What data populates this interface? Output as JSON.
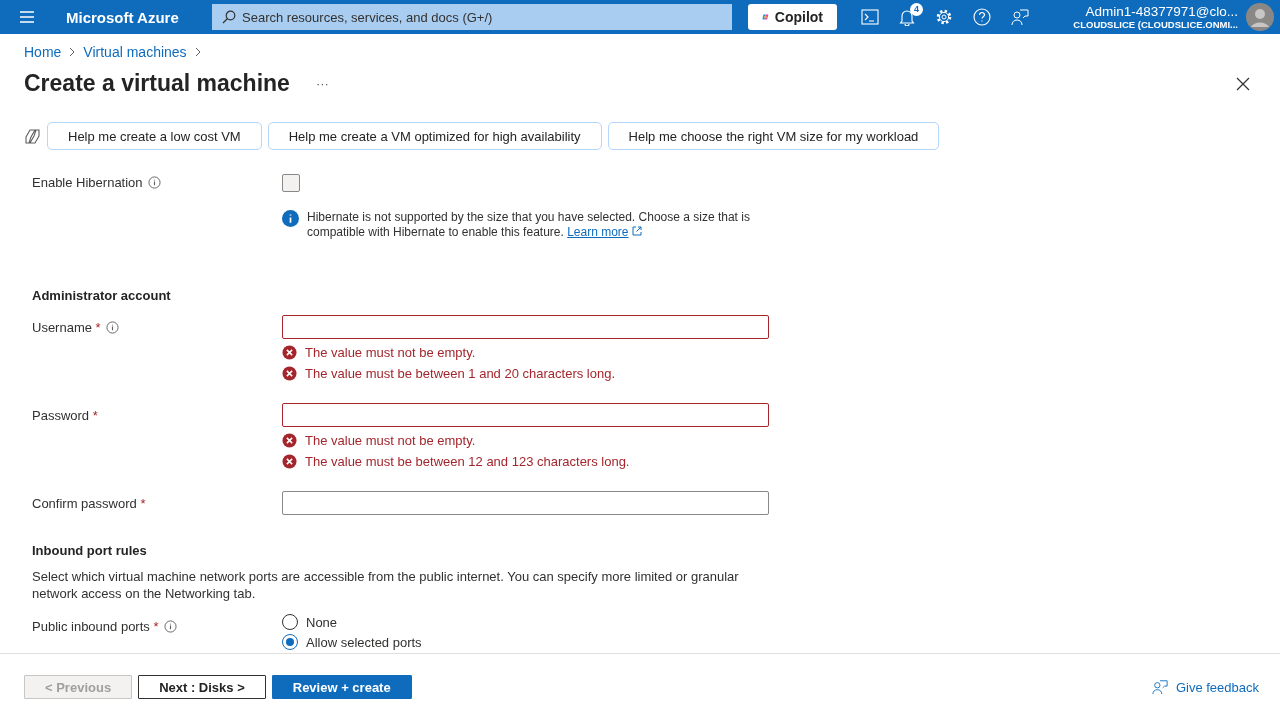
{
  "topbar": {
    "brand": "Microsoft Azure",
    "search": {
      "placeholder": "Search resources, services, and docs (G+/)"
    },
    "copilot": "Copilot",
    "notifications_badge": "4",
    "account": {
      "name": "Admin1-48377971@clo...",
      "tenant": "CLOUDSLICE (CLOUDSLICE.ONMI..."
    }
  },
  "breadcrumb": [
    "Home",
    "Virtual machines"
  ],
  "page": {
    "title": "Create a virtual machine",
    "more": "···"
  },
  "suggestions": [
    "Help me create a low cost VM",
    "Help me create a VM optimized for high availability",
    "Help me choose the right VM size for my workload"
  ],
  "hibernation": {
    "label": "Enable Hibernation",
    "checked": false,
    "info": "Hibernate is not supported by the size that you have selected. Choose a size that is compatible with Hibernate to enable this feature.",
    "link": "Learn more"
  },
  "admin": {
    "heading": "Administrator account",
    "fields": [
      {
        "label": "Username",
        "required_mark": "*",
        "info": true,
        "invalid": true,
        "errors": [
          "The value must not be empty.",
          "The value must be between 1 and 20 characters long."
        ]
      },
      {
        "label": "Password",
        "required_mark": "*",
        "info": false,
        "invalid": true,
        "errors": [
          "The value must not be empty.",
          "The value must be between 12 and 123 characters long."
        ]
      },
      {
        "label": "Confirm password",
        "required_mark": "*",
        "info": false,
        "invalid": false
      }
    ]
  },
  "inbound": {
    "heading": "Inbound port rules",
    "description": "Select which virtual machine network ports are accessible from the public internet. You can specify more limited or granular network access on the Networking tab.",
    "ports": {
      "label": "Public inbound ports",
      "required_mark": "*",
      "options": [
        {
          "label": "None",
          "selected": false
        },
        {
          "label": "Allow selected ports",
          "selected": true
        }
      ]
    }
  },
  "footer": {
    "buttons": [
      {
        "label": "< Previous",
        "kind": "secondary",
        "disabled": true
      },
      {
        "label": "Next : Disks >",
        "kind": "secondary",
        "disabled": false
      },
      {
        "label": "Review + create",
        "kind": "primary",
        "disabled": false
      }
    ],
    "feedback": "Give feedback"
  }
}
